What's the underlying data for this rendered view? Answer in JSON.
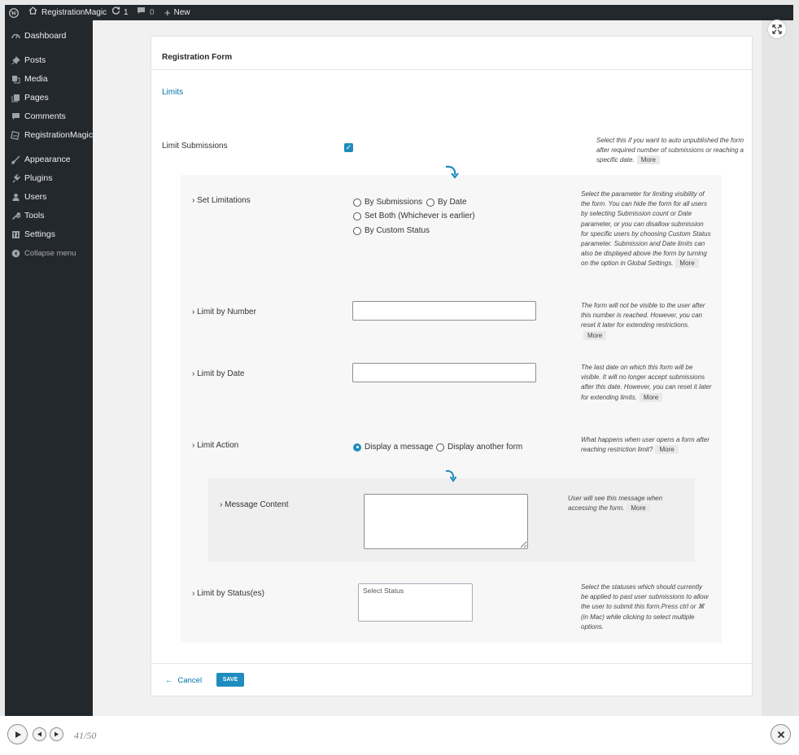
{
  "adminbar": {
    "site_name": "RegistrationMagic",
    "updates_count": "1",
    "comments_count": "0",
    "new_label": "New"
  },
  "sidebar": {
    "items": [
      {
        "label": "Dashboard",
        "icon": "dashboard-icon"
      },
      {
        "label": "Posts",
        "icon": "pin-icon"
      },
      {
        "label": "Media",
        "icon": "media-icon"
      },
      {
        "label": "Pages",
        "icon": "pages-icon"
      },
      {
        "label": "Comments",
        "icon": "comment-icon"
      },
      {
        "label": "RegistrationMagic",
        "icon": "registrationmagic-icon"
      },
      {
        "label": "Appearance",
        "icon": "brush-icon"
      },
      {
        "label": "Plugins",
        "icon": "plugin-icon"
      },
      {
        "label": "Users",
        "icon": "user-icon"
      },
      {
        "label": "Tools",
        "icon": "wrench-icon"
      },
      {
        "label": "Settings",
        "icon": "settings-icon"
      }
    ],
    "collapse_label": "Collapse menu"
  },
  "card": {
    "title": "Registration Form",
    "limits_link": "Limits"
  },
  "limit_submissions": {
    "label": "Limit Submissions",
    "checked": true,
    "help": "Select this if you want to auto unpublished the form after required number of submissions or reaching a specific date."
  },
  "more_label": "More",
  "set_limitations": {
    "label": "Set Limitations",
    "options": [
      "By Submissions",
      "By Date",
      "Set Both (Whichever is earlier)",
      "By Custom Status"
    ],
    "help": "Select the parameter for limiting visibility of the form. You can hide the form for all users by selecting Submission count or Date parameter, or you can disallow submission for specific users by choosing Custom Status parameter. Submission and Date limits can also be displayed above the form by turning on the option in Global Settings."
  },
  "limit_by_number": {
    "label": "Limit by Number",
    "value": "",
    "help": "The form will not be visible to the user after this number is reached. However, you can reset it later for extending restrictions."
  },
  "limit_by_date": {
    "label": "Limit by Date",
    "value": "",
    "help": "The last date on which this form will be visible. It will no longer accept submissions after this date. However, you can reset it later for extending limits."
  },
  "limit_action": {
    "label": "Limit Action",
    "options": [
      "Display a message",
      "Display another form"
    ],
    "selected": "Display a message",
    "help": "What happens when user opens a form after reaching restriction limit?"
  },
  "message_content": {
    "label": "Message Content",
    "value": "",
    "help": "User will see this message when accessing the form."
  },
  "limit_by_status": {
    "label": "Limit by Status(es)",
    "placeholder": "Select Status",
    "help": "Select the statuses which should currently be applied to past user submissions to allow the user to submit this form.Press ctrl or ⌘ (in Mac) while clicking to select multiple options."
  },
  "footer": {
    "cancel_label": "Cancel",
    "save_label": "SAVE"
  },
  "player": {
    "counter": "41/50"
  }
}
